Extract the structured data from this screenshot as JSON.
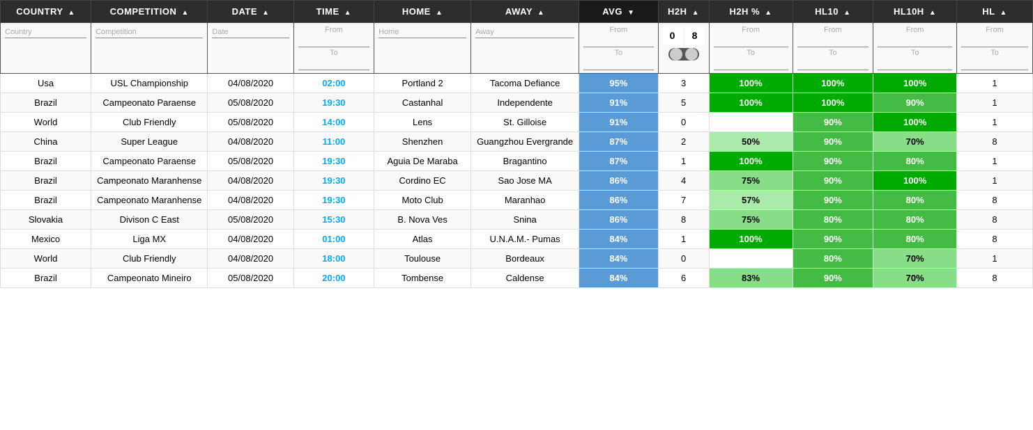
{
  "headers": [
    {
      "id": "country",
      "label": "COUNTRY",
      "sort": "asc"
    },
    {
      "id": "competition",
      "label": "COMPETITION",
      "sort": "asc"
    },
    {
      "id": "date",
      "label": "DATE",
      "sort": "asc"
    },
    {
      "id": "time",
      "label": "TIME",
      "sort": "asc"
    },
    {
      "id": "home",
      "label": "HOME",
      "sort": "asc"
    },
    {
      "id": "away",
      "label": "AWAY",
      "sort": "asc"
    },
    {
      "id": "avg",
      "label": "AVG",
      "sort": "desc"
    },
    {
      "id": "h2h",
      "label": "H2H",
      "sort": "asc"
    },
    {
      "id": "h2h_pct",
      "label": "H2H %",
      "sort": "asc"
    },
    {
      "id": "hl10",
      "label": "HL10",
      "sort": "asc"
    },
    {
      "id": "hl10h",
      "label": "HL10H",
      "sort": "asc"
    },
    {
      "id": "hl",
      "label": "HL",
      "sort": "asc"
    }
  ],
  "filters": {
    "country_placeholder": "Country",
    "competition_placeholder": "Competition",
    "date_placeholder": "Date",
    "from_label": "From",
    "to_label": "To",
    "home_placeholder": "Home",
    "away_placeholder": "Away",
    "h2h_from": "0",
    "h2h_to": "8"
  },
  "rows": [
    {
      "country": "Usa",
      "competition": "USL Championship",
      "date": "04/08/2020",
      "time": "02:00",
      "home": "Portland 2",
      "away": "Tacoma Defiance",
      "avg": "95%",
      "h2h": "3",
      "h2h_pct": "100%",
      "hl10": "100%",
      "hl10h": "100%",
      "hl": "1",
      "h2h_pct_class": "green-dark",
      "hl10_class": "green-dark",
      "hl10h_class": "green-dark"
    },
    {
      "country": "Brazil",
      "competition": "Campeonato Paraense",
      "date": "05/08/2020",
      "time": "19:30",
      "home": "Castanhal",
      "away": "Independente",
      "avg": "91%",
      "h2h": "5",
      "h2h_pct": "100%",
      "hl10": "100%",
      "hl10h": "90%",
      "hl": "1",
      "h2h_pct_class": "green-dark",
      "hl10_class": "green-dark",
      "hl10h_class": "green-med"
    },
    {
      "country": "World",
      "competition": "Club Friendly",
      "date": "05/08/2020",
      "time": "14:00",
      "home": "Lens",
      "away": "St. Gilloise",
      "avg": "91%",
      "h2h": "0",
      "h2h_pct": "",
      "hl10": "90%",
      "hl10h": "100%",
      "hl": "1",
      "h2h_pct_class": "empty-cell",
      "hl10_class": "green-med",
      "hl10h_class": "green-dark"
    },
    {
      "country": "China",
      "competition": "Super League",
      "date": "04/08/2020",
      "time": "11:00",
      "home": "Shenzhen",
      "away": "Guangzhou Evergrande",
      "avg": "87%",
      "h2h": "2",
      "h2h_pct": "50%",
      "hl10": "90%",
      "hl10h": "70%",
      "hl": "8",
      "h2h_pct_class": "green-pale",
      "hl10_class": "green-med",
      "hl10h_class": "green-light"
    },
    {
      "country": "Brazil",
      "competition": "Campeonato Paraense",
      "date": "05/08/2020",
      "time": "19:30",
      "home": "Aguia De Maraba",
      "away": "Bragantino",
      "avg": "87%",
      "h2h": "1",
      "h2h_pct": "100%",
      "hl10": "90%",
      "hl10h": "80%",
      "hl": "1",
      "h2h_pct_class": "green-dark",
      "hl10_class": "green-med",
      "hl10h_class": "green-med"
    },
    {
      "country": "Brazil",
      "competition": "Campeonato Maranhense",
      "date": "04/08/2020",
      "time": "19:30",
      "home": "Cordino EC",
      "away": "Sao Jose MA",
      "avg": "86%",
      "h2h": "4",
      "h2h_pct": "75%",
      "hl10": "90%",
      "hl10h": "100%",
      "hl": "1",
      "h2h_pct_class": "green-light",
      "hl10_class": "green-med",
      "hl10h_class": "green-dark"
    },
    {
      "country": "Brazil",
      "competition": "Campeonato Maranhense",
      "date": "04/08/2020",
      "time": "19:30",
      "home": "Moto Club",
      "away": "Maranhao",
      "avg": "86%",
      "h2h": "7",
      "h2h_pct": "57%",
      "hl10": "90%",
      "hl10h": "80%",
      "hl": "8",
      "h2h_pct_class": "green-pale",
      "hl10_class": "green-med",
      "hl10h_class": "green-med"
    },
    {
      "country": "Slovakia",
      "competition": "Divison C East",
      "date": "05/08/2020",
      "time": "15:30",
      "home": "B. Nova Ves",
      "away": "Snina",
      "avg": "86%",
      "h2h": "8",
      "h2h_pct": "75%",
      "hl10": "80%",
      "hl10h": "80%",
      "hl": "8",
      "h2h_pct_class": "green-light",
      "hl10_class": "green-med",
      "hl10h_class": "green-med"
    },
    {
      "country": "Mexico",
      "competition": "Liga MX",
      "date": "04/08/2020",
      "time": "01:00",
      "home": "Atlas",
      "away": "U.N.A.M.- Pumas",
      "avg": "84%",
      "h2h": "1",
      "h2h_pct": "100%",
      "hl10": "90%",
      "hl10h": "80%",
      "hl": "8",
      "h2h_pct_class": "green-dark",
      "hl10_class": "green-med",
      "hl10h_class": "green-med"
    },
    {
      "country": "World",
      "competition": "Club Friendly",
      "date": "04/08/2020",
      "time": "18:00",
      "home": "Toulouse",
      "away": "Bordeaux",
      "avg": "84%",
      "h2h": "0",
      "h2h_pct": "",
      "hl10": "80%",
      "hl10h": "70%",
      "hl": "1",
      "h2h_pct_class": "empty-cell",
      "hl10_class": "green-med",
      "hl10h_class": "green-light"
    },
    {
      "country": "Brazil",
      "competition": "Campeonato Mineiro",
      "date": "05/08/2020",
      "time": "20:00",
      "home": "Tombense",
      "away": "Caldense",
      "avg": "84%",
      "h2h": "6",
      "h2h_pct": "83%",
      "hl10": "90%",
      "hl10h": "70%",
      "hl": "8",
      "h2h_pct_class": "green-light",
      "hl10_class": "green-med",
      "hl10h_class": "green-light"
    }
  ]
}
